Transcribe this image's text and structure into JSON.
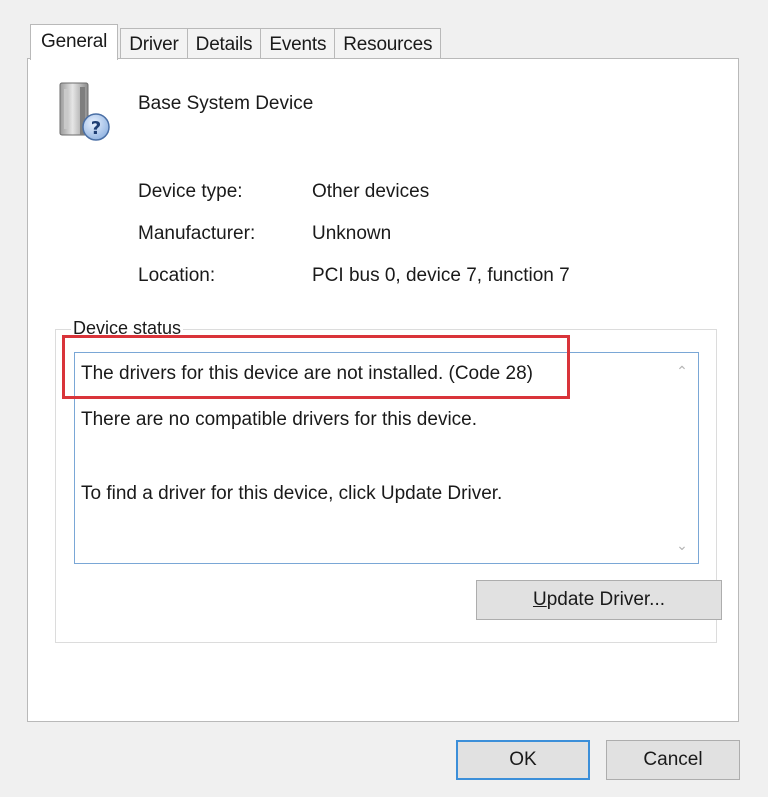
{
  "tabs": [
    {
      "label": "General",
      "active": true
    },
    {
      "label": "Driver",
      "active": false
    },
    {
      "label": "Details",
      "active": false
    },
    {
      "label": "Events",
      "active": false
    },
    {
      "label": "Resources",
      "active": false
    }
  ],
  "device": {
    "name": "Base System Device",
    "icon": "unknown-device-icon"
  },
  "properties": {
    "type_label": "Device type:",
    "type_value": "Other devices",
    "manufacturer_label": "Manufacturer:",
    "manufacturer_value": "Unknown",
    "location_label": "Location:",
    "location_value": "PCI bus 0, device 7, function 7"
  },
  "status": {
    "legend": "Device status",
    "line1": "The drivers for this device are not installed. (Code 28)",
    "line2": "There are no compatible drivers for this device.",
    "line3": "To find a driver for this device, click Update Driver.",
    "highlight_color": "#d9343a"
  },
  "buttons": {
    "update_mnemonic": "U",
    "update_rest": "pdate Driver...",
    "ok": "OK",
    "cancel": "Cancel"
  }
}
